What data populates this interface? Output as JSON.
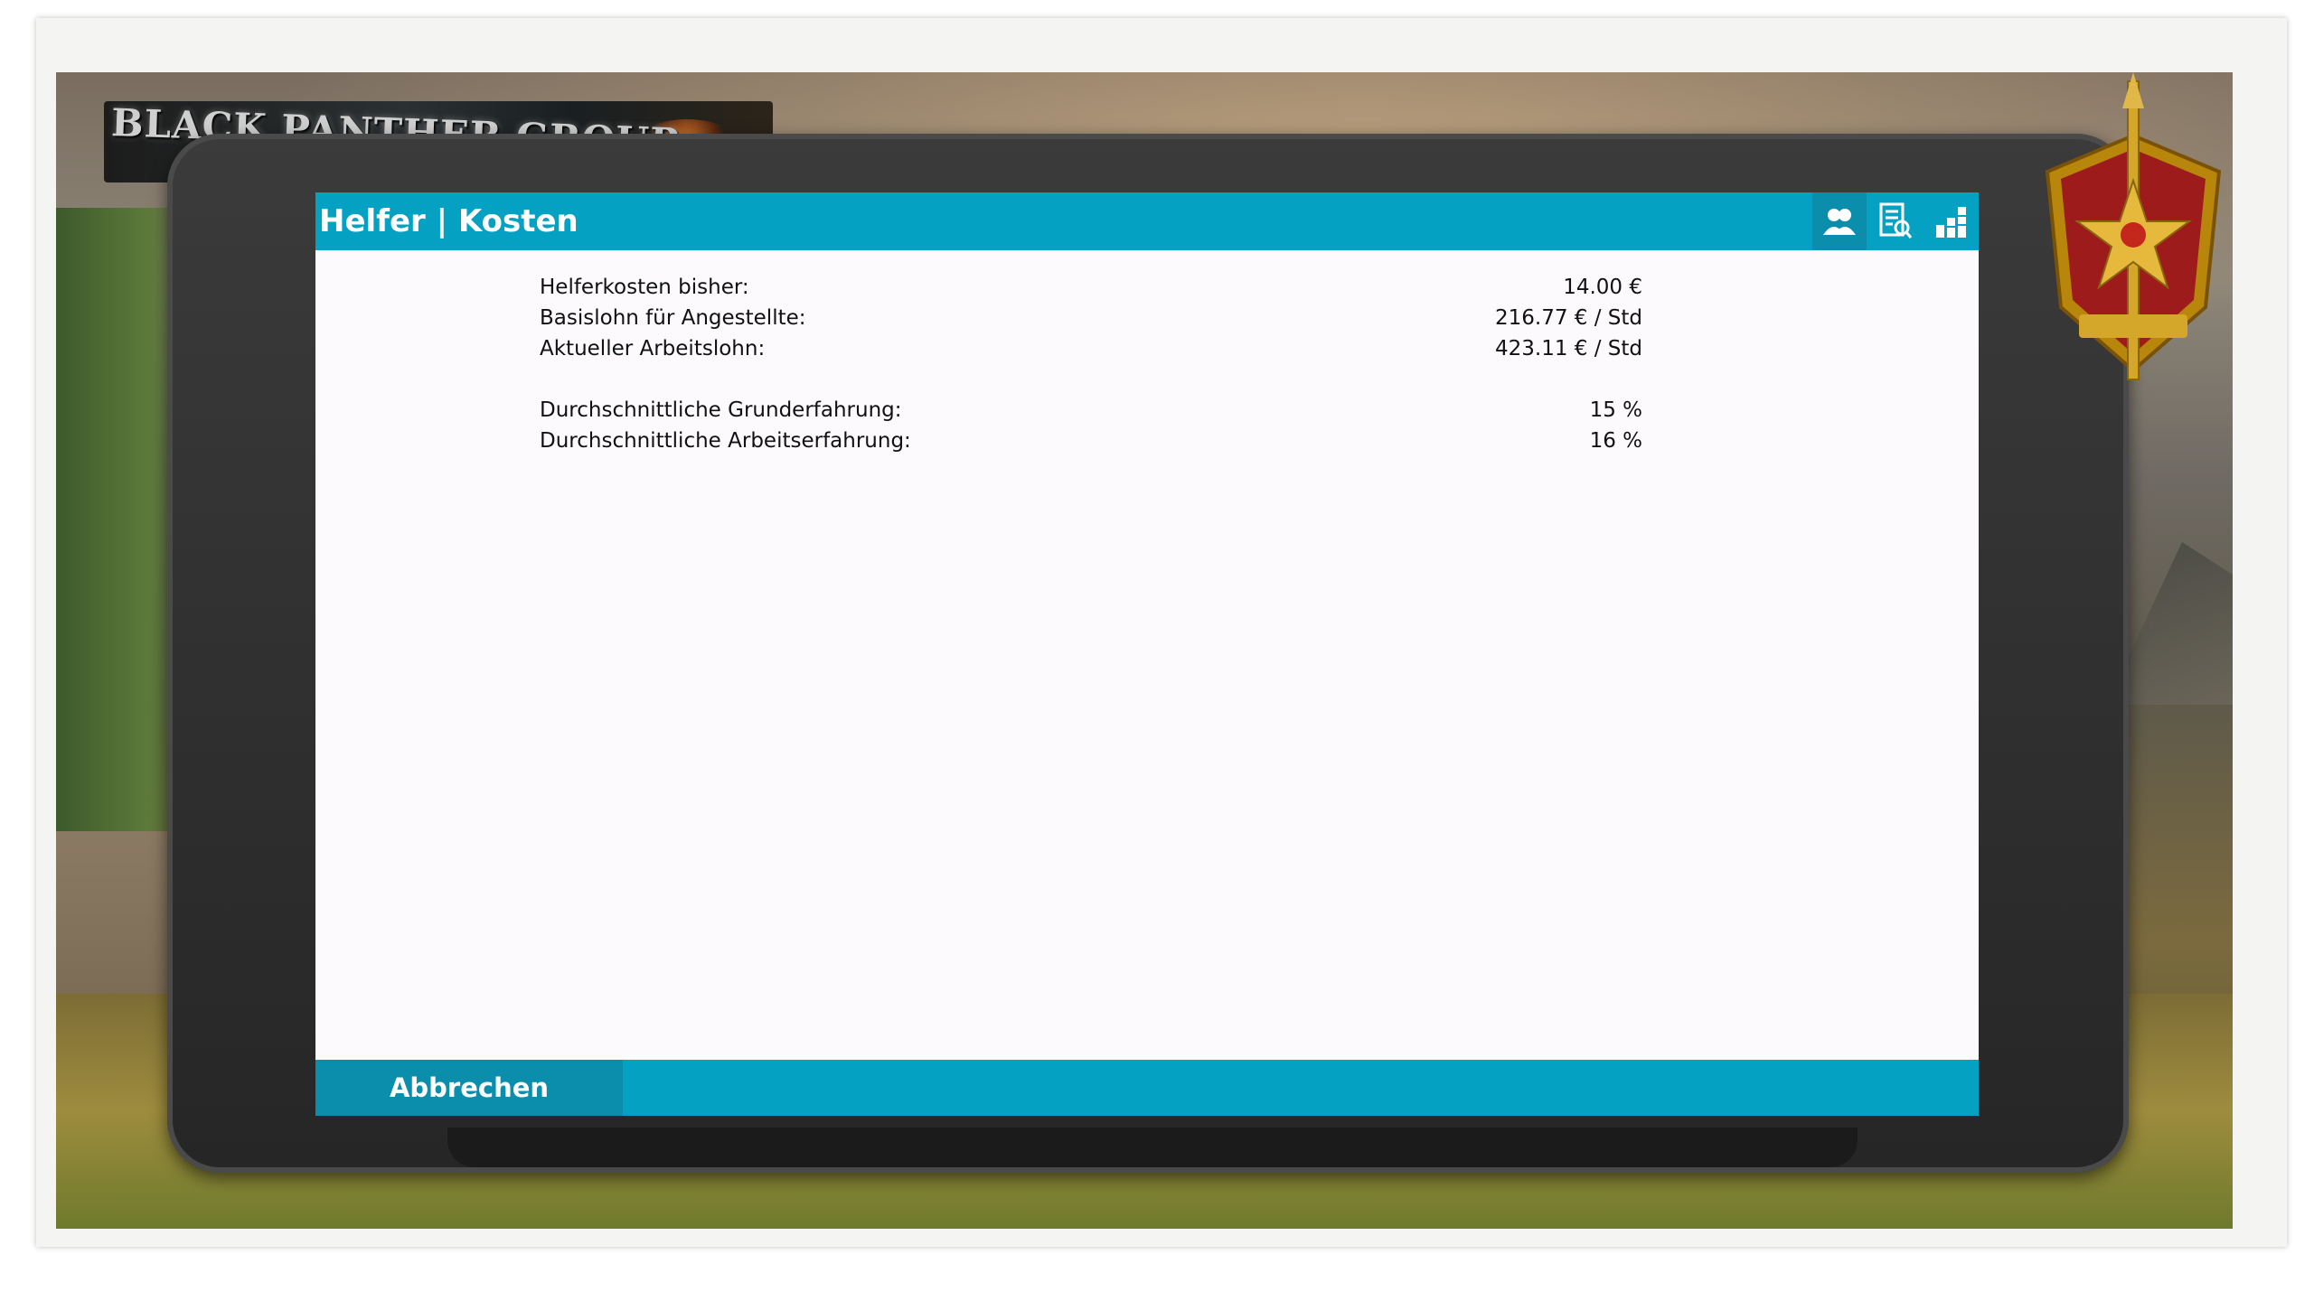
{
  "logo": {
    "text": "BLACK PANTHER GROUP"
  },
  "dialog": {
    "title": "Helfer | Kosten",
    "tabs": [
      {
        "icon": "helpers-icon",
        "active": true
      },
      {
        "icon": "costs-document-icon",
        "active": false
      },
      {
        "icon": "statistics-icon",
        "active": false
      }
    ],
    "rows": [
      {
        "label": "Helferkosten bisher:",
        "value": "14.00 €"
      },
      {
        "label": "Basislohn für Angestellte:",
        "value": "216.77 € / Std"
      },
      {
        "label": "Aktueller Arbeitslohn:",
        "value": "423.11 € / Std"
      },
      {
        "label": "Durchschnittliche Grunderfahrung:",
        "value": "15 %"
      },
      {
        "label": "Durchschnittliche Arbeitserfahrung:",
        "value": "16 %"
      }
    ],
    "cancel_label": "Abbrechen"
  },
  "colors": {
    "accent": "#05a1c2",
    "accent_dark": "#0a8eab",
    "screen_bg": "#fcfafd"
  }
}
